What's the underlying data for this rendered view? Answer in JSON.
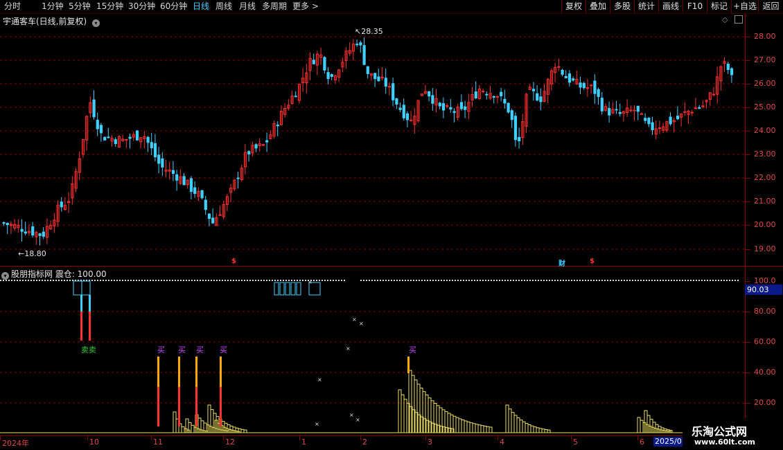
{
  "toolbar": {
    "periods": [
      "分时",
      "1分钟",
      "5分钟",
      "15分钟",
      "30分钟",
      "60分钟",
      "日线",
      "周线",
      "月线",
      "多周期",
      "更多 >"
    ],
    "active_period": "日线",
    "right_buttons": [
      "复权",
      "叠加",
      "多股",
      "统计",
      "画线",
      "F10",
      "标记",
      "+自选",
      "返回"
    ]
  },
  "main_panel": {
    "title": "宇通客车(日线,前复权)",
    "high_label": "28.35",
    "low_label": "18.80",
    "markers": [
      {
        "text": "$",
        "color": "#ff3030"
      },
      {
        "text": "财",
        "color": "#3fd0ff"
      },
      {
        "text": "$",
        "color": "#ff3030"
      }
    ],
    "y_ticks": [
      "28.00",
      "27.00",
      "26.00",
      "25.00",
      "24.00",
      "23.00",
      "22.00",
      "21.00",
      "20.00",
      "19.00"
    ]
  },
  "indicator_panel": {
    "title": "股朋指标网 震仓: 100.00",
    "current_value": "90.03",
    "y_ticks": [
      "100.0",
      "80.00",
      "60.00",
      "40.00",
      "20.00"
    ],
    "sell_label": "卖卖",
    "buy_label": "买"
  },
  "x_axis": {
    "labels": [
      "2024年",
      "10",
      "11",
      "12",
      "1",
      "2",
      "3",
      "4",
      "5",
      "6"
    ],
    "current_date": "2025/0"
  },
  "watermark": {
    "title": "乐淘公式网",
    "url": "www.60lt.com"
  },
  "colors": {
    "up": "#ff3030",
    "down": "#3fd0ff",
    "grid": "#8b0000",
    "volume": "#f0e060",
    "sell": "#33cc33",
    "buy": "#cc44ff"
  },
  "chart_data": {
    "type": "candlestick",
    "y_range": [
      18.5,
      28.6
    ],
    "high": 28.35,
    "low": 18.8,
    "indicator_range": [
      0,
      100
    ],
    "indicator_last": 90.03
  }
}
